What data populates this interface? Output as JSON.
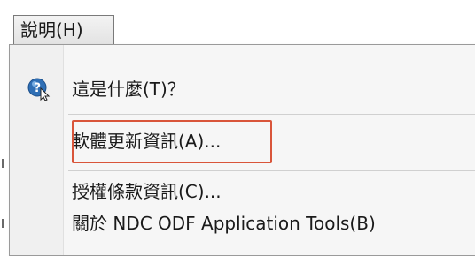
{
  "menu_bar": {
    "help_menu": "說明(H)"
  },
  "dropdown": {
    "items": [
      {
        "label": "這是什麼(T)？",
        "icon": "help-pointer-icon"
      },
      {
        "label": "軟體更新資訊(A)..."
      },
      {
        "label": "授權條款資訊(C)..."
      },
      {
        "label": "關於 NDC ODF Application Tools(B)"
      }
    ],
    "highlighted_item": "軟體更新資訊(A)...",
    "highlight_color": "#d9553a"
  }
}
